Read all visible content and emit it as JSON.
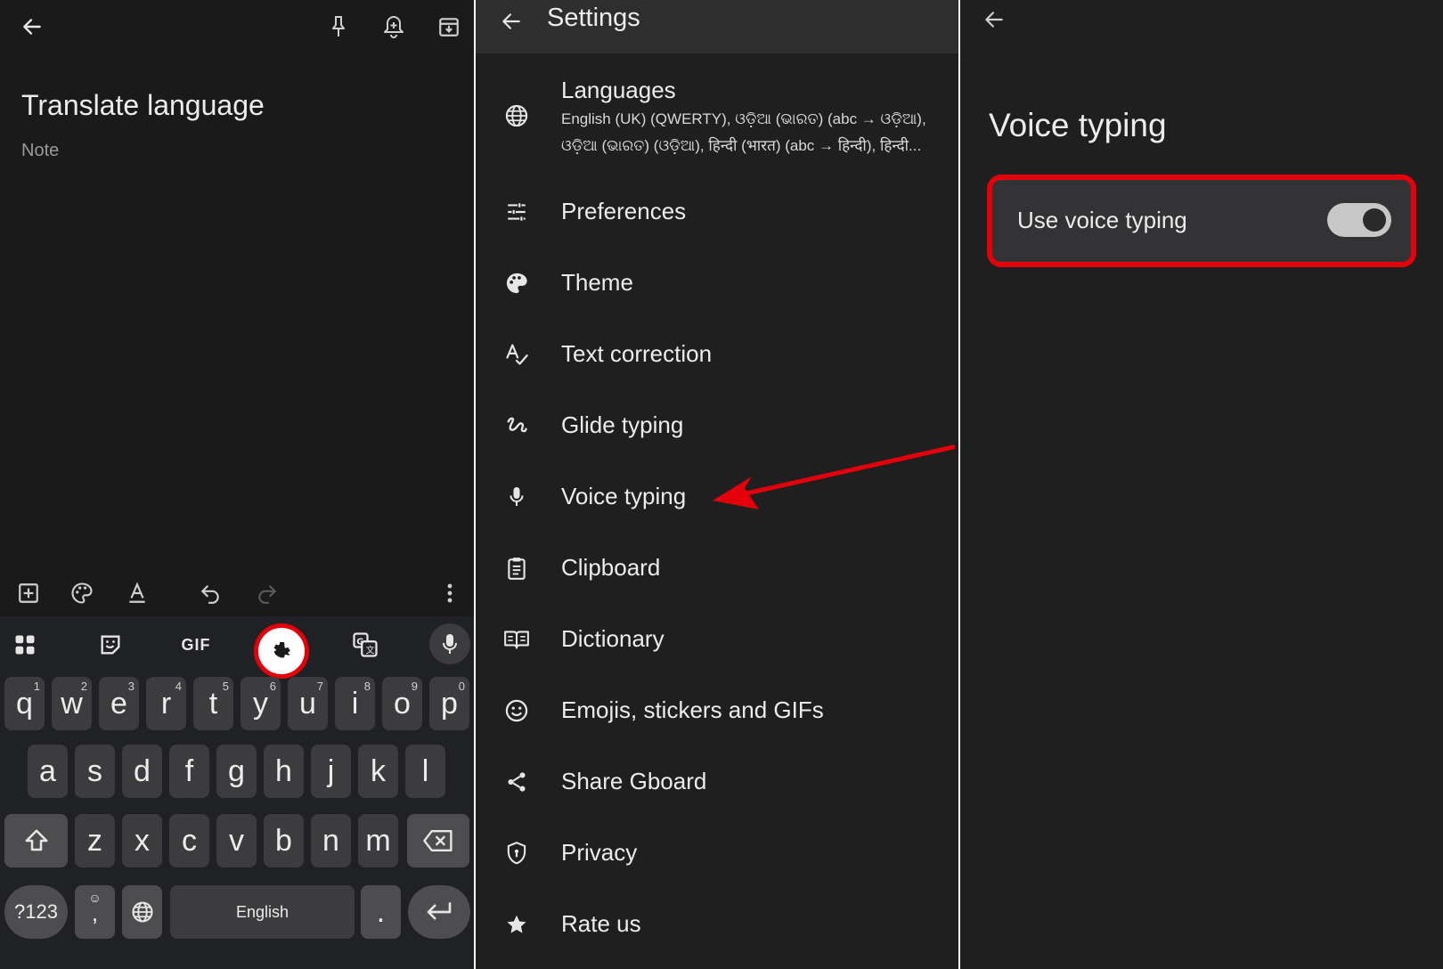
{
  "note_panel": {
    "title": "Translate language",
    "body_placeholder": "Note",
    "toolbar_icons": [
      "back-arrow-icon",
      "pin-icon",
      "reminder-bell-icon",
      "archive-icon"
    ],
    "format_icons": [
      "add-box-icon",
      "palette-icon",
      "text-format-icon",
      "undo-icon",
      "redo-icon",
      "more-vert-icon"
    ]
  },
  "keyboard": {
    "toolbar": {
      "gif_label": "GIF",
      "icons": [
        "apps-grid-icon",
        "sticker-icon",
        "gif-icon",
        "settings-gear-icon",
        "translate-icon",
        "mic-icon"
      ]
    },
    "row1": [
      {
        "key": "q",
        "hint": "1"
      },
      {
        "key": "w",
        "hint": "2"
      },
      {
        "key": "e",
        "hint": "3"
      },
      {
        "key": "r",
        "hint": "4"
      },
      {
        "key": "t",
        "hint": "5"
      },
      {
        "key": "y",
        "hint": "6"
      },
      {
        "key": "u",
        "hint": "7"
      },
      {
        "key": "i",
        "hint": "8"
      },
      {
        "key": "o",
        "hint": "9"
      },
      {
        "key": "p",
        "hint": "0"
      }
    ],
    "row2": [
      "a",
      "s",
      "d",
      "f",
      "g",
      "h",
      "j",
      "k",
      "l"
    ],
    "row3": [
      "z",
      "x",
      "c",
      "v",
      "b",
      "n",
      "m"
    ],
    "symbols_label": "?123",
    "comma_label": ",",
    "space_label": "English",
    "period_label": "."
  },
  "settings_panel": {
    "title": "Settings",
    "languages": {
      "label": "Languages",
      "line1": "English (UK) (QWERTY), ଓଡ଼ିଆ (ଭାରତ) (abc → ଓଡ଼ିଆ),",
      "line2": "ଓଡ଼ିଆ (ଭାରତ) (ଓଡ଼ିଆ), हिन्दी (भारत) (abc → हिन्दी), हिन्दी..."
    },
    "items": [
      {
        "label": "Preferences",
        "icon": "tune-sliders-icon"
      },
      {
        "label": "Theme",
        "icon": "palette-icon"
      },
      {
        "label": "Text correction",
        "icon": "spellcheck-icon"
      },
      {
        "label": "Glide typing",
        "icon": "gesture-icon"
      },
      {
        "label": "Voice typing",
        "icon": "mic-icon"
      },
      {
        "label": "Clipboard",
        "icon": "clipboard-icon"
      },
      {
        "label": "Dictionary",
        "icon": "book-icon"
      },
      {
        "label": "Emojis, stickers and GIFs",
        "icon": "emoji-icon"
      },
      {
        "label": "Share Gboard",
        "icon": "share-icon"
      },
      {
        "label": "Privacy",
        "icon": "shield-icon"
      },
      {
        "label": "Rate us",
        "icon": "star-icon"
      }
    ]
  },
  "voice_panel": {
    "title": "Voice typing",
    "option_label": "Use voice typing",
    "toggle_on": true
  },
  "colors": {
    "highlight": "#e4000b",
    "background": "#1f1f1f",
    "keyboard": "#202124",
    "key": "#3c3c3e"
  }
}
